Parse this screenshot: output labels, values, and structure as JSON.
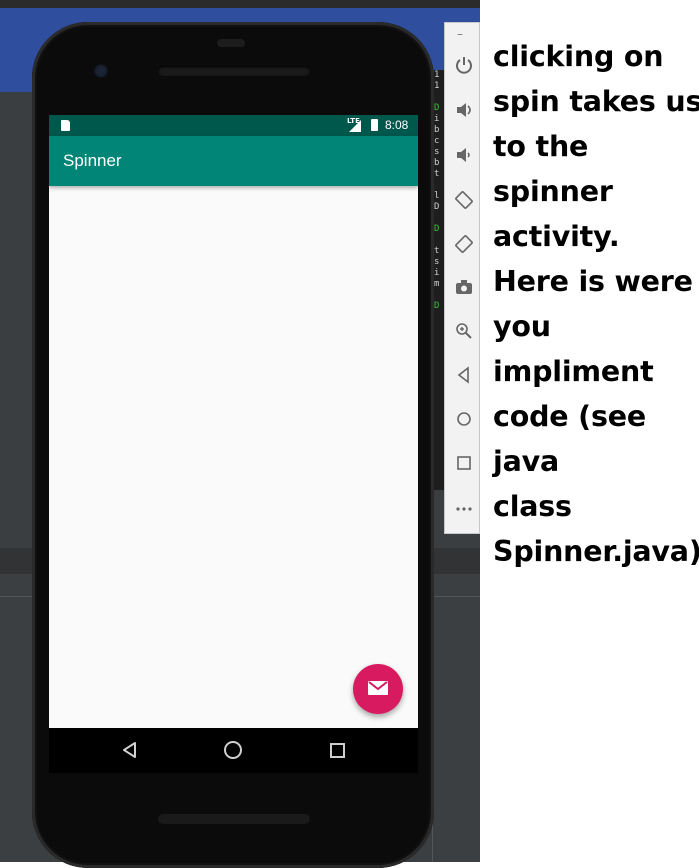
{
  "status_bar": {
    "network_label": "LTE",
    "time": "8:08"
  },
  "app_bar": {
    "title": "Spinner"
  },
  "fab": {
    "icon": "email-icon",
    "color": "#d81b60"
  },
  "nav_bar": {
    "back_icon": "back-triangle-icon",
    "home_icon": "home-circle-icon",
    "recents_icon": "recents-square-icon"
  },
  "emulator_toolbar": {
    "items": [
      "power-icon",
      "volume-up-icon",
      "volume-down-icon",
      "rotate-left-icon",
      "rotate-right-icon",
      "camera-icon",
      "zoom-icon",
      "back-icon",
      "home-icon",
      "overview-icon",
      "more-icon"
    ]
  },
  "log_text": {
    "lines": [
      "1",
      "1",
      "",
      "D",
      "i",
      "b",
      "c",
      "s",
      "b",
      "t",
      "",
      "l",
      "D",
      "",
      "D",
      "",
      "t",
      "s",
      "i",
      "m",
      "",
      "D"
    ]
  },
  "annotation": {
    "lines": [
      "clicking on",
      "spin takes us",
      "to the",
      "spinner",
      "activity.",
      "Here is were",
      "you",
      "impliment",
      "code (see",
      "java",
      "class",
      "Spinner.java)"
    ]
  },
  "colors": {
    "app_bar": "#008577",
    "status_bar": "#00574b",
    "accent": "#d81b60"
  }
}
